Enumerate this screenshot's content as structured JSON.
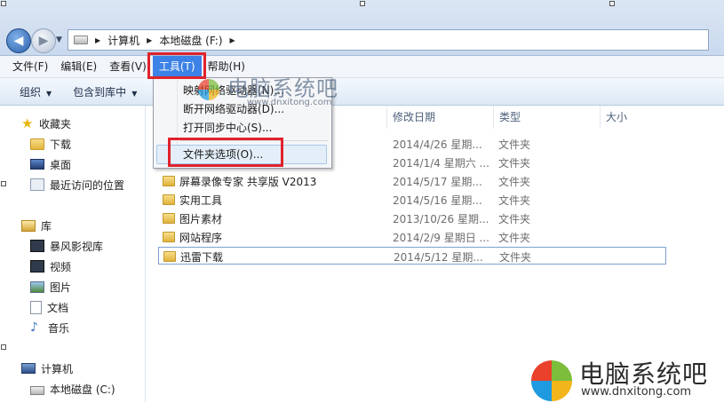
{
  "address_bar": {
    "crumbs": [
      "计算机",
      "本地磁盘 (F:)"
    ]
  },
  "menubar": {
    "items": [
      "文件(F)",
      "编辑(E)",
      "查看(V)",
      "工具(T)",
      "帮助(H)"
    ]
  },
  "commandbar": {
    "organize": "组织",
    "include_in_library": "包含到库中"
  },
  "nav_pane": {
    "favorites": "收藏夹",
    "downloads": "下载",
    "desktop": "桌面",
    "recent": "最近访问的位置",
    "libraries": "库",
    "storm_video": "暴风影视库",
    "videos": "视频",
    "pictures": "图片",
    "documents": "文档",
    "music": "音乐",
    "computer": "计算机",
    "local_disk_c": "本地磁盘 (C:)"
  },
  "columns": {
    "modified": "修改日期",
    "type": "类型",
    "size": "大小"
  },
  "files": [
    {
      "name": "",
      "date": "2014/4/26 星期...",
      "type": "文件夹"
    },
    {
      "name": "",
      "date": "2014/1/4 星期六 ...",
      "type": "文件夹"
    },
    {
      "name": "屏幕录像专家 共享版 V2013",
      "date": "2014/5/17 星期...",
      "type": "文件夹"
    },
    {
      "name": "实用工具",
      "date": "2014/5/16 星期...",
      "type": "文件夹"
    },
    {
      "name": "图片素材",
      "date": "2013/10/26 星期...",
      "type": "文件夹"
    },
    {
      "name": "网站程序",
      "date": "2014/2/9 星期日 ...",
      "type": "文件夹"
    },
    {
      "name": "迅雷下载",
      "date": "2014/5/12 星期...",
      "type": "文件夹"
    }
  ],
  "tools_menu": {
    "map_drive": "映射网络驱动器(N)...",
    "disconnect_drive": "断开网络驱动器(D)...",
    "sync_center": "打开同步中心(S)...",
    "folder_options": "文件夹选项(O)..."
  },
  "watermark": {
    "title": "电脑系统吧",
    "url": "www.dnxitong.com"
  },
  "colors": {
    "menu_active": "#3d82e6",
    "annotation_red": "#e0222b"
  }
}
